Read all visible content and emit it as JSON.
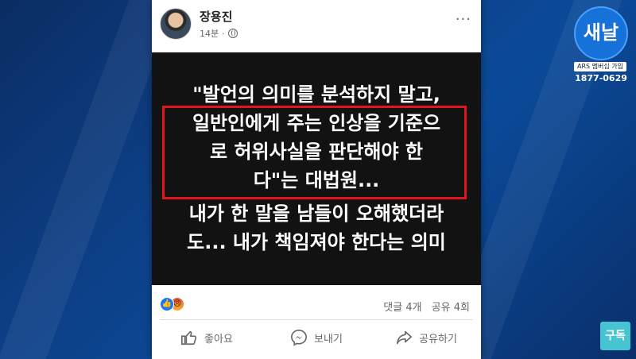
{
  "post": {
    "author": "장용진",
    "time": "14분",
    "more_label": "···",
    "image_text": {
      "line1": "\"발언의 의미를 분석하지 말고,",
      "line2": "일반인에게 주는 인상을 기준으",
      "line3": "로 허위사실을 판단해야 한",
      "line4": "다\"는 대법원...",
      "line5": "내가 한 말을 남들이 오해했더라",
      "line6": "도... 내가 책임져야 한다는 의미"
    },
    "comments": "댓글 4개",
    "shares": "공유 4회",
    "actions": {
      "like": "좋아요",
      "send": "보내기",
      "share": "공유하기"
    }
  },
  "channel": {
    "logo_text": "새날",
    "ars_label": "ARS 멤버십 가입",
    "phone": "1877-0629",
    "subscribe": "구독"
  },
  "colors": {
    "highlight_box": "#e0161f",
    "fb_blue": "#1877f2"
  }
}
